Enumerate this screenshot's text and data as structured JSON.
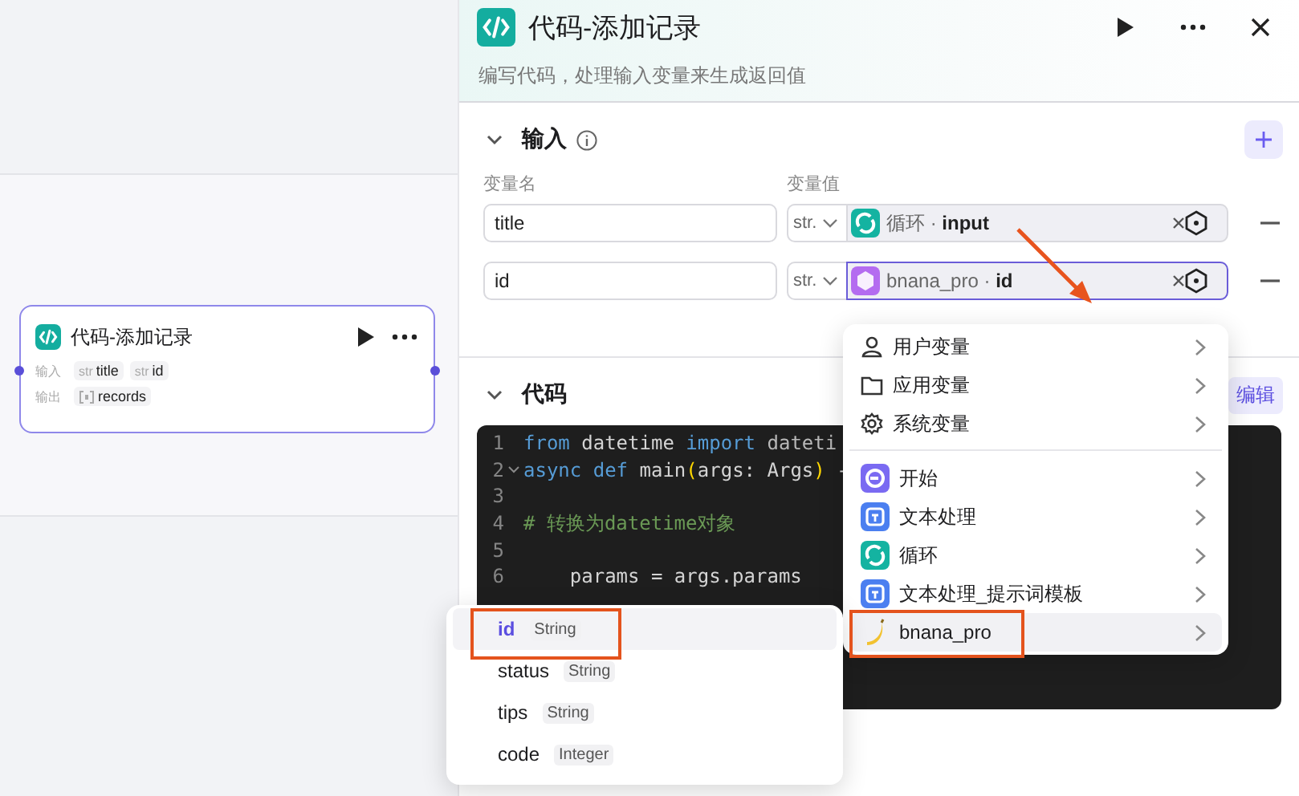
{
  "canvas": {
    "node": {
      "title": "代码-添加记录",
      "input_label": "输入",
      "inputs": [
        {
          "type": "str",
          "name": "title"
        },
        {
          "type": "str",
          "name": "id"
        }
      ],
      "output_label": "输出",
      "outputs": [
        {
          "name": "records"
        }
      ]
    }
  },
  "panel": {
    "title": "代码-添加记录",
    "description": "编写代码，处理输入变量来生成返回值",
    "input_section": {
      "title": "输入",
      "expanded": true,
      "columns": [
        "变量名",
        "变量值"
      ],
      "rows": [
        {
          "name": "title",
          "type": "str.",
          "ref_node": "循环",
          "separator": "·",
          "ref_field": "input",
          "color": "#14b3a1",
          "selected": false
        },
        {
          "name": "id",
          "type": "str.",
          "ref_node": "bnana_pro",
          "separator": "·",
          "ref_field": "id",
          "color": "#b46cf0",
          "selected": true
        }
      ]
    },
    "code_section": {
      "title": "代码",
      "expanded": true,
      "edit_button": "编辑",
      "lines": [
        {
          "number": "1",
          "fold": false,
          "tokens": [
            {
              "kind": "keyword",
              "text": "from"
            },
            {
              "kind": "plain",
              "text": " datetime "
            },
            {
              "kind": "keyword",
              "text": "import"
            },
            {
              "kind": "dim",
              "text": " dateti"
            }
          ]
        },
        {
          "number": "2",
          "fold": true,
          "tokens": [
            {
              "kind": "keyword",
              "text": "async def"
            },
            {
              "kind": "plain",
              "text": " main"
            },
            {
              "kind": "paren",
              "text": "("
            },
            {
              "kind": "plain",
              "text": "args: Args"
            },
            {
              "kind": "paren",
              "text": ")"
            },
            {
              "kind": "plain",
              "text": " -"
            }
          ]
        },
        {
          "number": "3",
          "fold": false
        },
        {
          "number": "4",
          "fold": false,
          "tokens": [
            {
              "kind": "comment",
              "text": "# 转换为datetime对象"
            }
          ]
        },
        {
          "number": "5",
          "fold": false
        },
        {
          "number": "6",
          "fold": false,
          "tokens": [
            {
              "kind": "plain",
              "text": "    params = args.params"
            }
          ]
        }
      ]
    }
  },
  "variable_menu": {
    "sections": [
      {
        "items": [
          {
            "kind": "user",
            "label": "用户变量",
            "selected": false
          },
          {
            "kind": "folder",
            "label": "应用变量",
            "selected": false
          },
          {
            "kind": "gear",
            "label": "系统变量",
            "selected": false
          }
        ]
      },
      {
        "items": [
          {
            "kind": "start",
            "label": "开始",
            "color": "#7a6af2",
            "selected": false
          },
          {
            "kind": "text",
            "label": "文本处理",
            "color": "#4b7ff0",
            "selected": false
          },
          {
            "kind": "loop",
            "label": "循环",
            "color": "#14b3a1",
            "selected": false
          },
          {
            "kind": "text",
            "label": "文本处理_提示词模板",
            "color": "#4b7ff0",
            "selected": false
          },
          {
            "kind": "banana",
            "label": "bnana_pro",
            "color": "#f2c230",
            "selected": true
          }
        ]
      }
    ]
  },
  "field_menu": {
    "items": [
      {
        "name": "id",
        "type": "String",
        "selected": true
      },
      {
        "name": "status",
        "type": "String",
        "selected": false
      },
      {
        "name": "tips",
        "type": "String",
        "selected": false
      },
      {
        "name": "code",
        "type": "Integer",
        "selected": false
      }
    ]
  }
}
